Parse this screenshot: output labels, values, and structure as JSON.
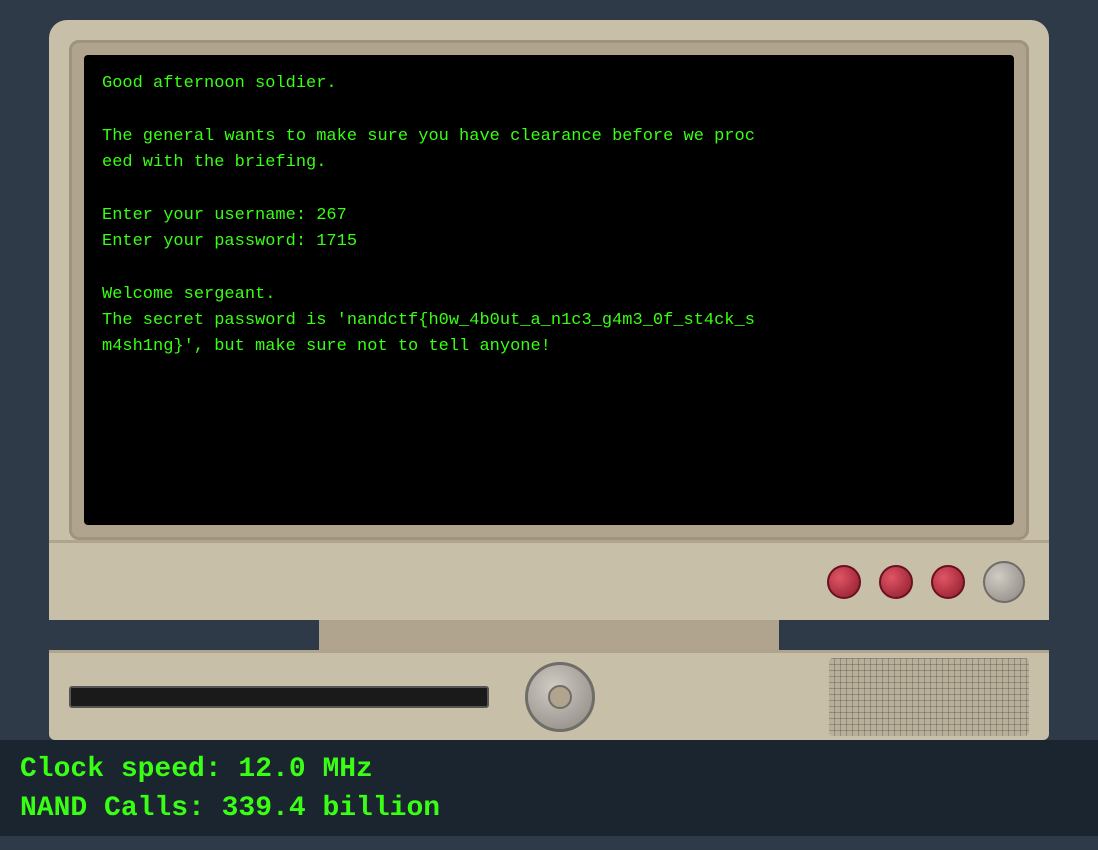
{
  "monitor": {
    "screen": {
      "lines": [
        "Good afternoon soldier.",
        "",
        "The general wants to make sure you have clearance before we proc",
        "eed with the briefing.",
        "",
        "Enter your username: 267",
        "Enter your password: 1715",
        "",
        "Welcome sergeant.",
        "The secret password is 'nandctf{h0w_4b0ut_a_n1c3_g4m3_0f_st4ck_s",
        "m4sh1ng}', but make sure not to tell anyone!"
      ]
    },
    "buttons": {
      "red1_label": "red-button-1",
      "red2_label": "red-button-2",
      "red3_label": "red-button-3",
      "gray_label": "gray-button"
    }
  },
  "status": {
    "clock_speed": "Clock speed: 12.0 MHz",
    "nand_calls": "NAND Calls: 339.4 billion"
  }
}
